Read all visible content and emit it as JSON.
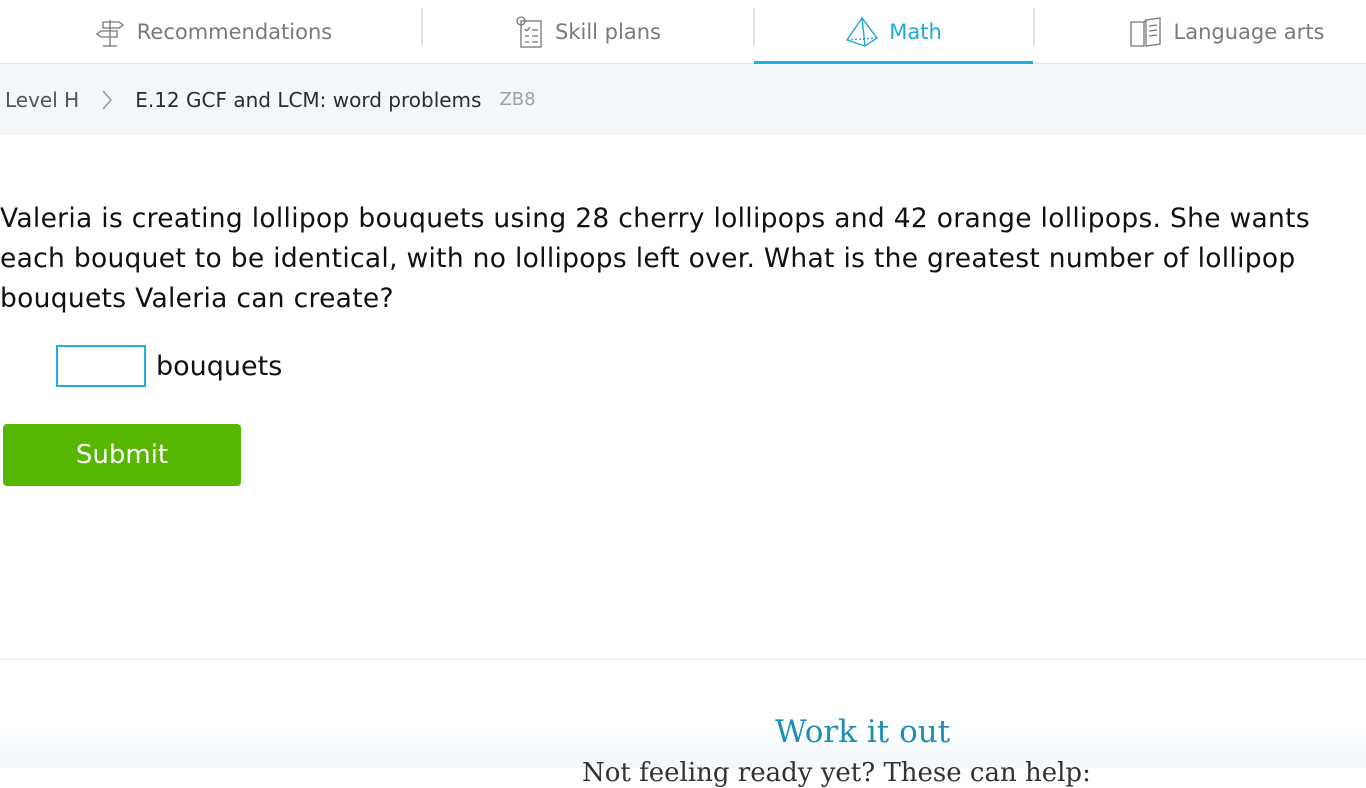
{
  "tabs": [
    {
      "label": "Recommendations",
      "icon": "signpost-icon"
    },
    {
      "label": "Skill plans",
      "icon": "checklist-icon"
    },
    {
      "label": "Math",
      "icon": "pyramid-icon",
      "active": true
    },
    {
      "label": "Language arts",
      "icon": "book-icon"
    }
  ],
  "breadcrumb": {
    "level": "Level H",
    "skill": "E.12 GCF and LCM: word problems",
    "code": "ZB8"
  },
  "question": {
    "text": "Valeria is creating lollipop bouquets using 28 cherry lollipops and 42 orange lollipops. She wants each bouquet to be identical, with no lollipops left over. What is the greatest number of lollipop bouquets Valeria can create?",
    "answer_value": "",
    "answer_unit": "bouquets",
    "submit_label": "Submit"
  },
  "help": {
    "title": "Work it out",
    "subtitle": "Not feeling ready yet? These can help:"
  },
  "colors": {
    "accent": "#1fa9d8",
    "submit": "#56b600",
    "help_title": "#1d8fb7"
  }
}
